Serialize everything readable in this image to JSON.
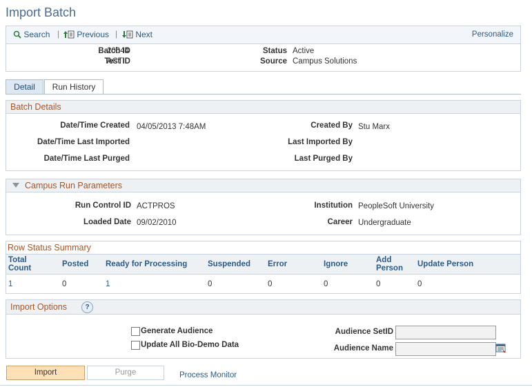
{
  "page": {
    "title": "Import Batch"
  },
  "toolbar": {
    "search": "Search",
    "previous": "Previous",
    "next": "Next",
    "personalize": "Personalize"
  },
  "header": {
    "batch_id_label": "Batch ID",
    "batch_id": "20044",
    "test_id_label": "Test ID",
    "test_id": "ACT",
    "status_label": "Status",
    "status": "Active",
    "source_label": "Source",
    "source": "Campus Solutions"
  },
  "tabs": [
    {
      "label": "Detail"
    },
    {
      "label": "Run History"
    }
  ],
  "batch_details": {
    "title": "Batch Details",
    "created_label": "Date/Time Created",
    "created": "04/05/2013  7:48AM",
    "last_imported_label": "Date/Time Last Imported",
    "last_imported": "",
    "last_purged_label": "Date/Time Last Purged",
    "last_purged": "",
    "created_by_label": "Created By",
    "created_by": "Stu Marx",
    "last_imported_by_label": "Last Imported By",
    "last_imported_by": "",
    "last_purged_by_label": "Last Purged By",
    "last_purged_by": ""
  },
  "campus_run": {
    "title": "Campus Run Parameters",
    "run_control_label": "Run Control ID",
    "run_control": "ACTPROS",
    "loaded_date_label": "Loaded Date",
    "loaded_date": "09/02/2010",
    "institution_label": "Institution",
    "institution": "PeopleSoft University",
    "career_label": "Career",
    "career": "Undergraduate"
  },
  "row_status": {
    "title": "Row Status Summary",
    "columns": [
      "Total\nCount",
      "Posted",
      "Ready for Processing",
      "Suspended",
      "Error",
      "Ignore",
      "Add\nPerson",
      "Update Person"
    ],
    "row": [
      "1",
      "0",
      "1",
      "0",
      "0",
      "0",
      "0",
      "0"
    ]
  },
  "import_options": {
    "title": "Import Options",
    "help": "?",
    "generate_audience": "Generate Audience",
    "update_bio_demo": "Update All Bio-Demo Data",
    "audience_setid_label": "Audience SetID",
    "audience_setid": "",
    "audience_name_label": "Audience Name",
    "audience_name": ""
  },
  "actions": {
    "import": "Import",
    "purge": "Purge",
    "process_monitor": "Process Monitor"
  },
  "colors": {
    "accent_title": "#4a6a8f",
    "link": "#2b5a88",
    "group_title": "#a2562a",
    "import_button": "#fde0b6"
  }
}
